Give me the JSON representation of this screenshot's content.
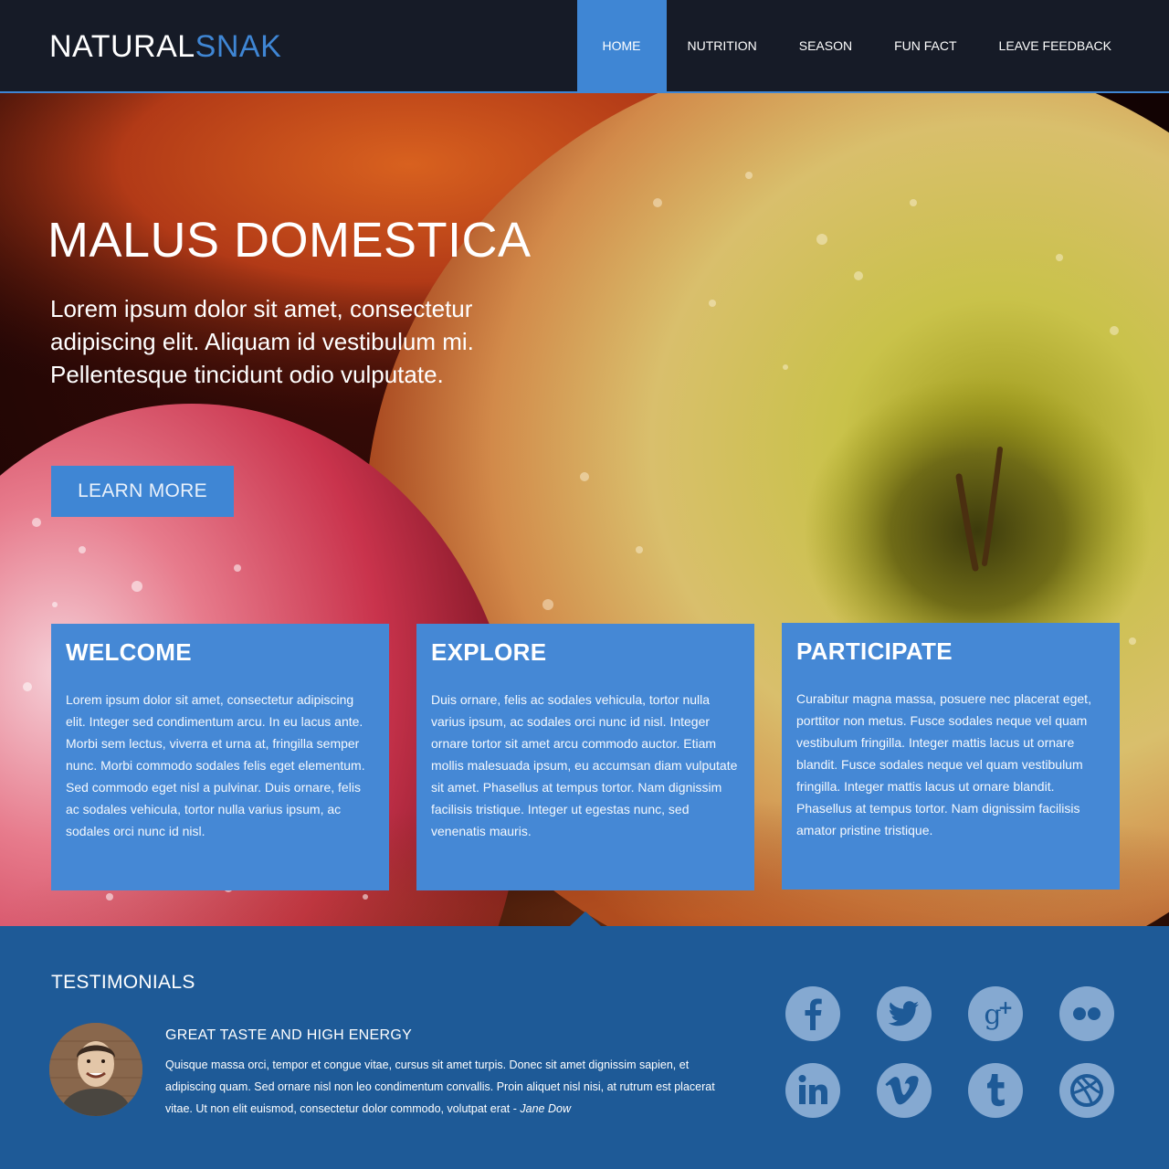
{
  "header": {
    "logo_main": "NATURAL",
    "logo_accent": "SNAK",
    "nav": [
      "HOME",
      "NUTRITION",
      "SEASON",
      "FUN FACT",
      "LEAVE FEEDBACK"
    ],
    "active_nav": "HOME"
  },
  "hero": {
    "title": "MALUS DOMESTICA",
    "text": "Lorem ipsum dolor sit amet, consectetur adipiscing elit. Aliquam id vestibulum mi. Pellentesque tincidunt odio vulputate.",
    "button_label": "LEARN MORE"
  },
  "cards": [
    {
      "title": "WELCOME",
      "text": "Lorem ipsum dolor sit amet, consectetur adipiscing elit. Integer sed condimentum arcu. In eu lacus ante. Morbi sem lectus, viverra et urna at, fringilla semper nunc. Morbi commodo sodales felis eget elementum. Sed commodo eget nisl a pulvinar. Duis ornare, felis ac sodales vehicula, tortor nulla varius ipsum, ac sodales orci nunc id nisl."
    },
    {
      "title": "EXPLORE",
      "text": "Duis ornare, felis ac sodales vehicula, tortor nulla varius ipsum, ac sodales orci nunc id nisl. Integer ornare tortor sit amet arcu commodo auctor. Etiam mollis malesuada ipsum, eu accumsan diam vulputate sit amet. Phasellus at tempus tortor. Nam dignissim facilisis tristique. Integer ut egestas nunc, sed venenatis mauris."
    },
    {
      "title": "PARTICIPATE",
      "text": "Curabitur magna massa, posuere nec placerat eget, porttitor non metus. Fusce sodales neque vel quam vestibulum fringilla. Integer mattis lacus ut ornare blandit. Fusce sodales neque vel quam vestibulum fringilla. Integer mattis lacus ut ornare blandit. Phasellus at tempus tortor. Nam dignissim facilisis amator pristine tristique."
    }
  ],
  "testimonials": {
    "heading": "TESTIMONIALS",
    "quote_title": "GREAT TASTE AND HIGH ENERGY",
    "quote_text": "Quisque massa orci, tempor et congue vitae, cursus sit amet turpis. Donec sit amet dignissim sapien, et adipiscing quam. Sed ornare nisl non leo condimentum convallis. Proin aliquet nisl nisi, at rutrum est placerat vitae. Ut non elit euismod, consectetur dolor commodo, volutpat erat - ",
    "author": "Jane Dow"
  },
  "social": [
    "facebook-icon",
    "twitter-icon",
    "google-plus-icon",
    "flickr-icon",
    "linkedin-icon",
    "vimeo-icon",
    "tumblr-icon",
    "dribbble-icon"
  ],
  "colors": {
    "header_bg": "#161b27",
    "accent": "#3f86d4",
    "card_bg": "#4588d5",
    "footer_bg": "#1e5a97",
    "social_icon": "#85a9d1"
  }
}
